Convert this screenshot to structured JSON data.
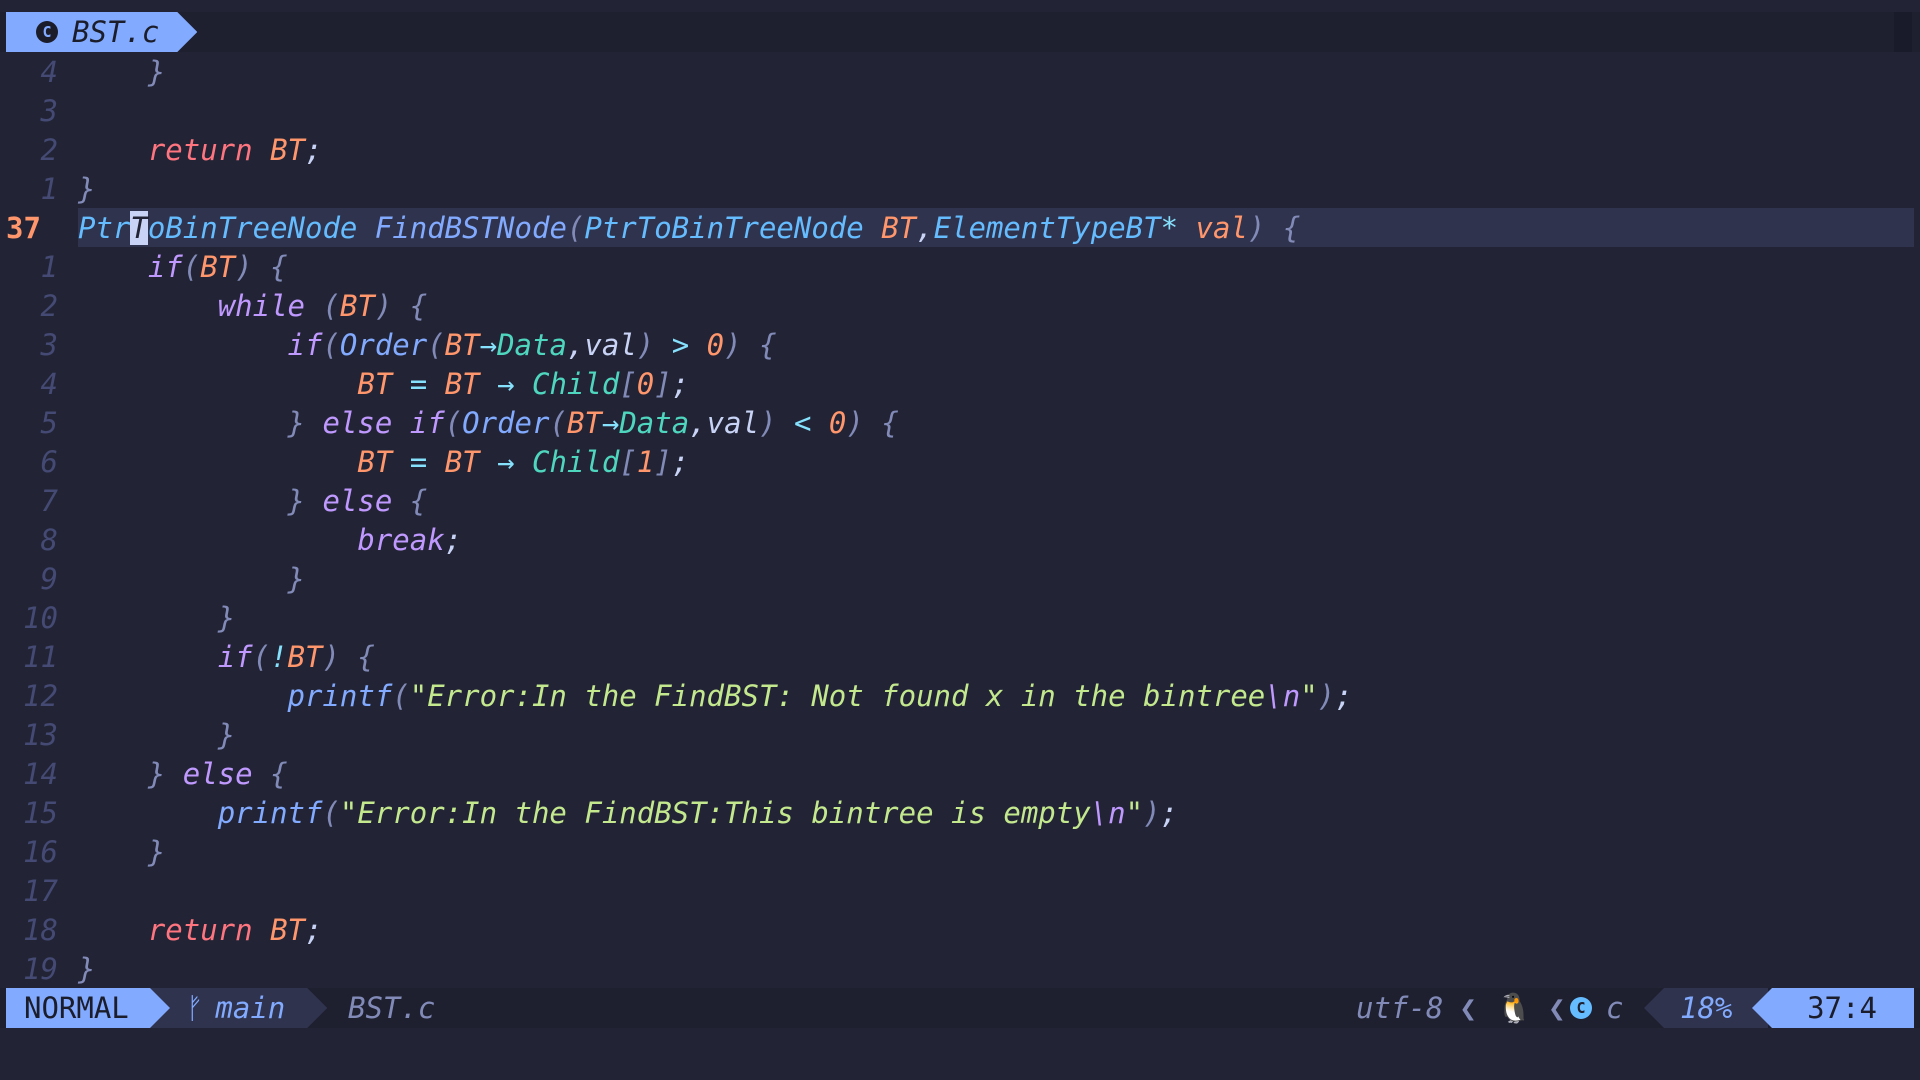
{
  "tabline": {
    "filename": "BST.c",
    "icon": "c-language-icon"
  },
  "editor": {
    "lines": [
      {
        "nr": "4"
      },
      {
        "nr": "3"
      },
      {
        "nr": "2"
      },
      {
        "nr": "1"
      },
      {
        "nr": "37"
      },
      {
        "nr": "1"
      },
      {
        "nr": "2"
      },
      {
        "nr": "3"
      },
      {
        "nr": "4"
      },
      {
        "nr": "5"
      },
      {
        "nr": "6"
      },
      {
        "nr": "7"
      },
      {
        "nr": "8"
      },
      {
        "nr": "9"
      },
      {
        "nr": "10"
      },
      {
        "nr": "11"
      },
      {
        "nr": "12"
      },
      {
        "nr": "13"
      },
      {
        "nr": "14"
      },
      {
        "nr": "15"
      },
      {
        "nr": "16"
      },
      {
        "nr": "17"
      },
      {
        "nr": "18"
      },
      {
        "nr": "19"
      }
    ],
    "tok": {
      "rbrace": "}",
      "lbrace": "{",
      "return": "return",
      "bt": "BT",
      "semi": ";",
      "ptr_p1": "Ptr",
      "ptr_cursor": "T",
      "ptr_p2": "oBinTreeNode",
      "find_fn": "FindBSTNode",
      "lparen": "(",
      "rparen": ")",
      "ptr_type": "PtrToBinTreeNode",
      "comma": ",",
      "elem_type": "ElementTypeBT",
      "star": "*",
      "val": "val",
      "if": "if",
      "while": "while",
      "order": "Order",
      "arrow": "→",
      "data": "Data",
      "gt": ">",
      "lt": "<",
      "zero": "0",
      "one": "1",
      "eq": "=",
      "child": "Child",
      "lbracket": "[",
      "rbracket": "]",
      "else": "else",
      "break": "break",
      "not": "!",
      "printf": "printf",
      "str1": "\"Error:In the FindBST: Not found x in the bintree",
      "esc_n": "\\n",
      "quote": "\"",
      "str2": "\"Error:In the FindBST:This bintree is empty"
    }
  },
  "statusline": {
    "mode": "NORMAL",
    "branch_icon": "git-branch-icon",
    "branch": "main",
    "filename": "BST.c",
    "encoding": "utf-8",
    "sep": "❮",
    "os_icon": "linux-tux-icon",
    "filetype_icon": "c-language-icon",
    "filetype": "c",
    "percent": "18%",
    "position": "37:4"
  }
}
